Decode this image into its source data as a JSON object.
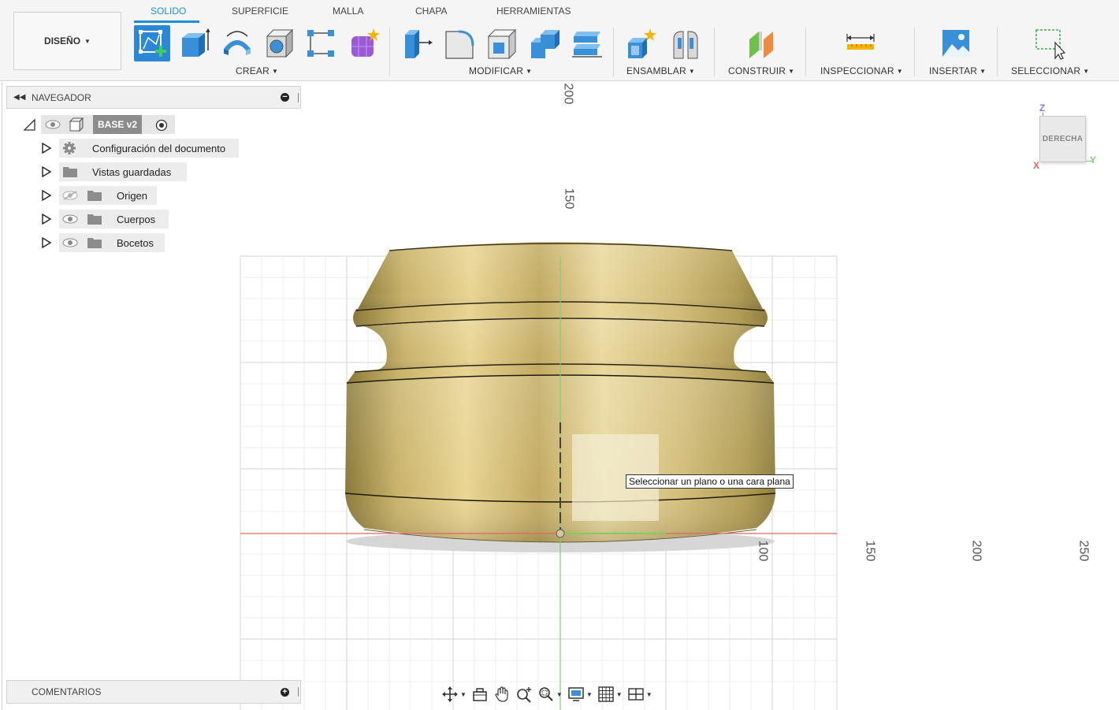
{
  "toolbar": {
    "workspace_button": "DISEÑO",
    "tabs": [
      {
        "label": "SOLIDO",
        "active": true
      },
      {
        "label": "SUPERFICIE",
        "active": false
      },
      {
        "label": "MALLA",
        "active": false
      },
      {
        "label": "CHAPA",
        "active": false
      },
      {
        "label": "HERRAMIENTAS",
        "active": false
      }
    ],
    "groups": {
      "crear": "CREAR",
      "modificar": "MODIFICAR",
      "ensamblar": "ENSAMBLAR",
      "construir": "CONSTRUIR",
      "inspeccionar": "INSPECCIONAR",
      "insertar": "INSERTAR",
      "seleccionar": "SELECCIONAR"
    },
    "tools": {
      "crear": [
        "create-sketch-icon",
        "extrude-icon",
        "revolve-icon",
        "hole-icon",
        "pattern-icon",
        "form-icon"
      ],
      "modificar": [
        "press-pull-icon",
        "fillet-icon",
        "shell-icon",
        "combine-icon",
        "align-icon"
      ],
      "ensamblar": [
        "new-component-icon",
        "joint-icon"
      ],
      "construir": [
        "offset-plane-icon"
      ],
      "inspeccionar": [
        "measure-icon"
      ],
      "insertar": [
        "insert-image-icon"
      ],
      "seleccionar": [
        "window-select-icon"
      ]
    },
    "accent_color": "#2b87d8"
  },
  "browser": {
    "header": "NAVEGADOR",
    "root": "BASE v2",
    "items": [
      {
        "label": "Configuración del documento",
        "icon": "gear-icon",
        "visible": null
      },
      {
        "label": "Vistas guardadas",
        "icon": "folder-icon",
        "visible": null
      },
      {
        "label": "Origen",
        "icon": "folder-icon",
        "visible": false
      },
      {
        "label": "Cuerpos",
        "icon": "folder-icon",
        "visible": true
      },
      {
        "label": "Bocetos",
        "icon": "folder-icon",
        "visible": true
      }
    ]
  },
  "comments": {
    "header": "COMENTARIOS"
  },
  "viewport": {
    "tooltip": "Seleccionar un plano o una cara plana",
    "axis_labels_vertical": [
      "200",
      "150"
    ],
    "axis_labels_horizontal": [
      "100",
      "150",
      "200",
      "250"
    ],
    "body_color": "#c9b36a",
    "x_axis_color": "#e06666",
    "y_axis_color": "#66cc66"
  },
  "viewcube": {
    "face": "DERECHA",
    "axis_z": "Z",
    "axis_y": "Y",
    "axis_x": "X"
  },
  "navbar": {
    "tools": [
      "orbit-icon",
      "look-at-icon",
      "pan-icon",
      "zoom-icon",
      "zoom-window-icon",
      "display-settings-icon",
      "grid-settings-icon",
      "viewports-icon"
    ]
  }
}
